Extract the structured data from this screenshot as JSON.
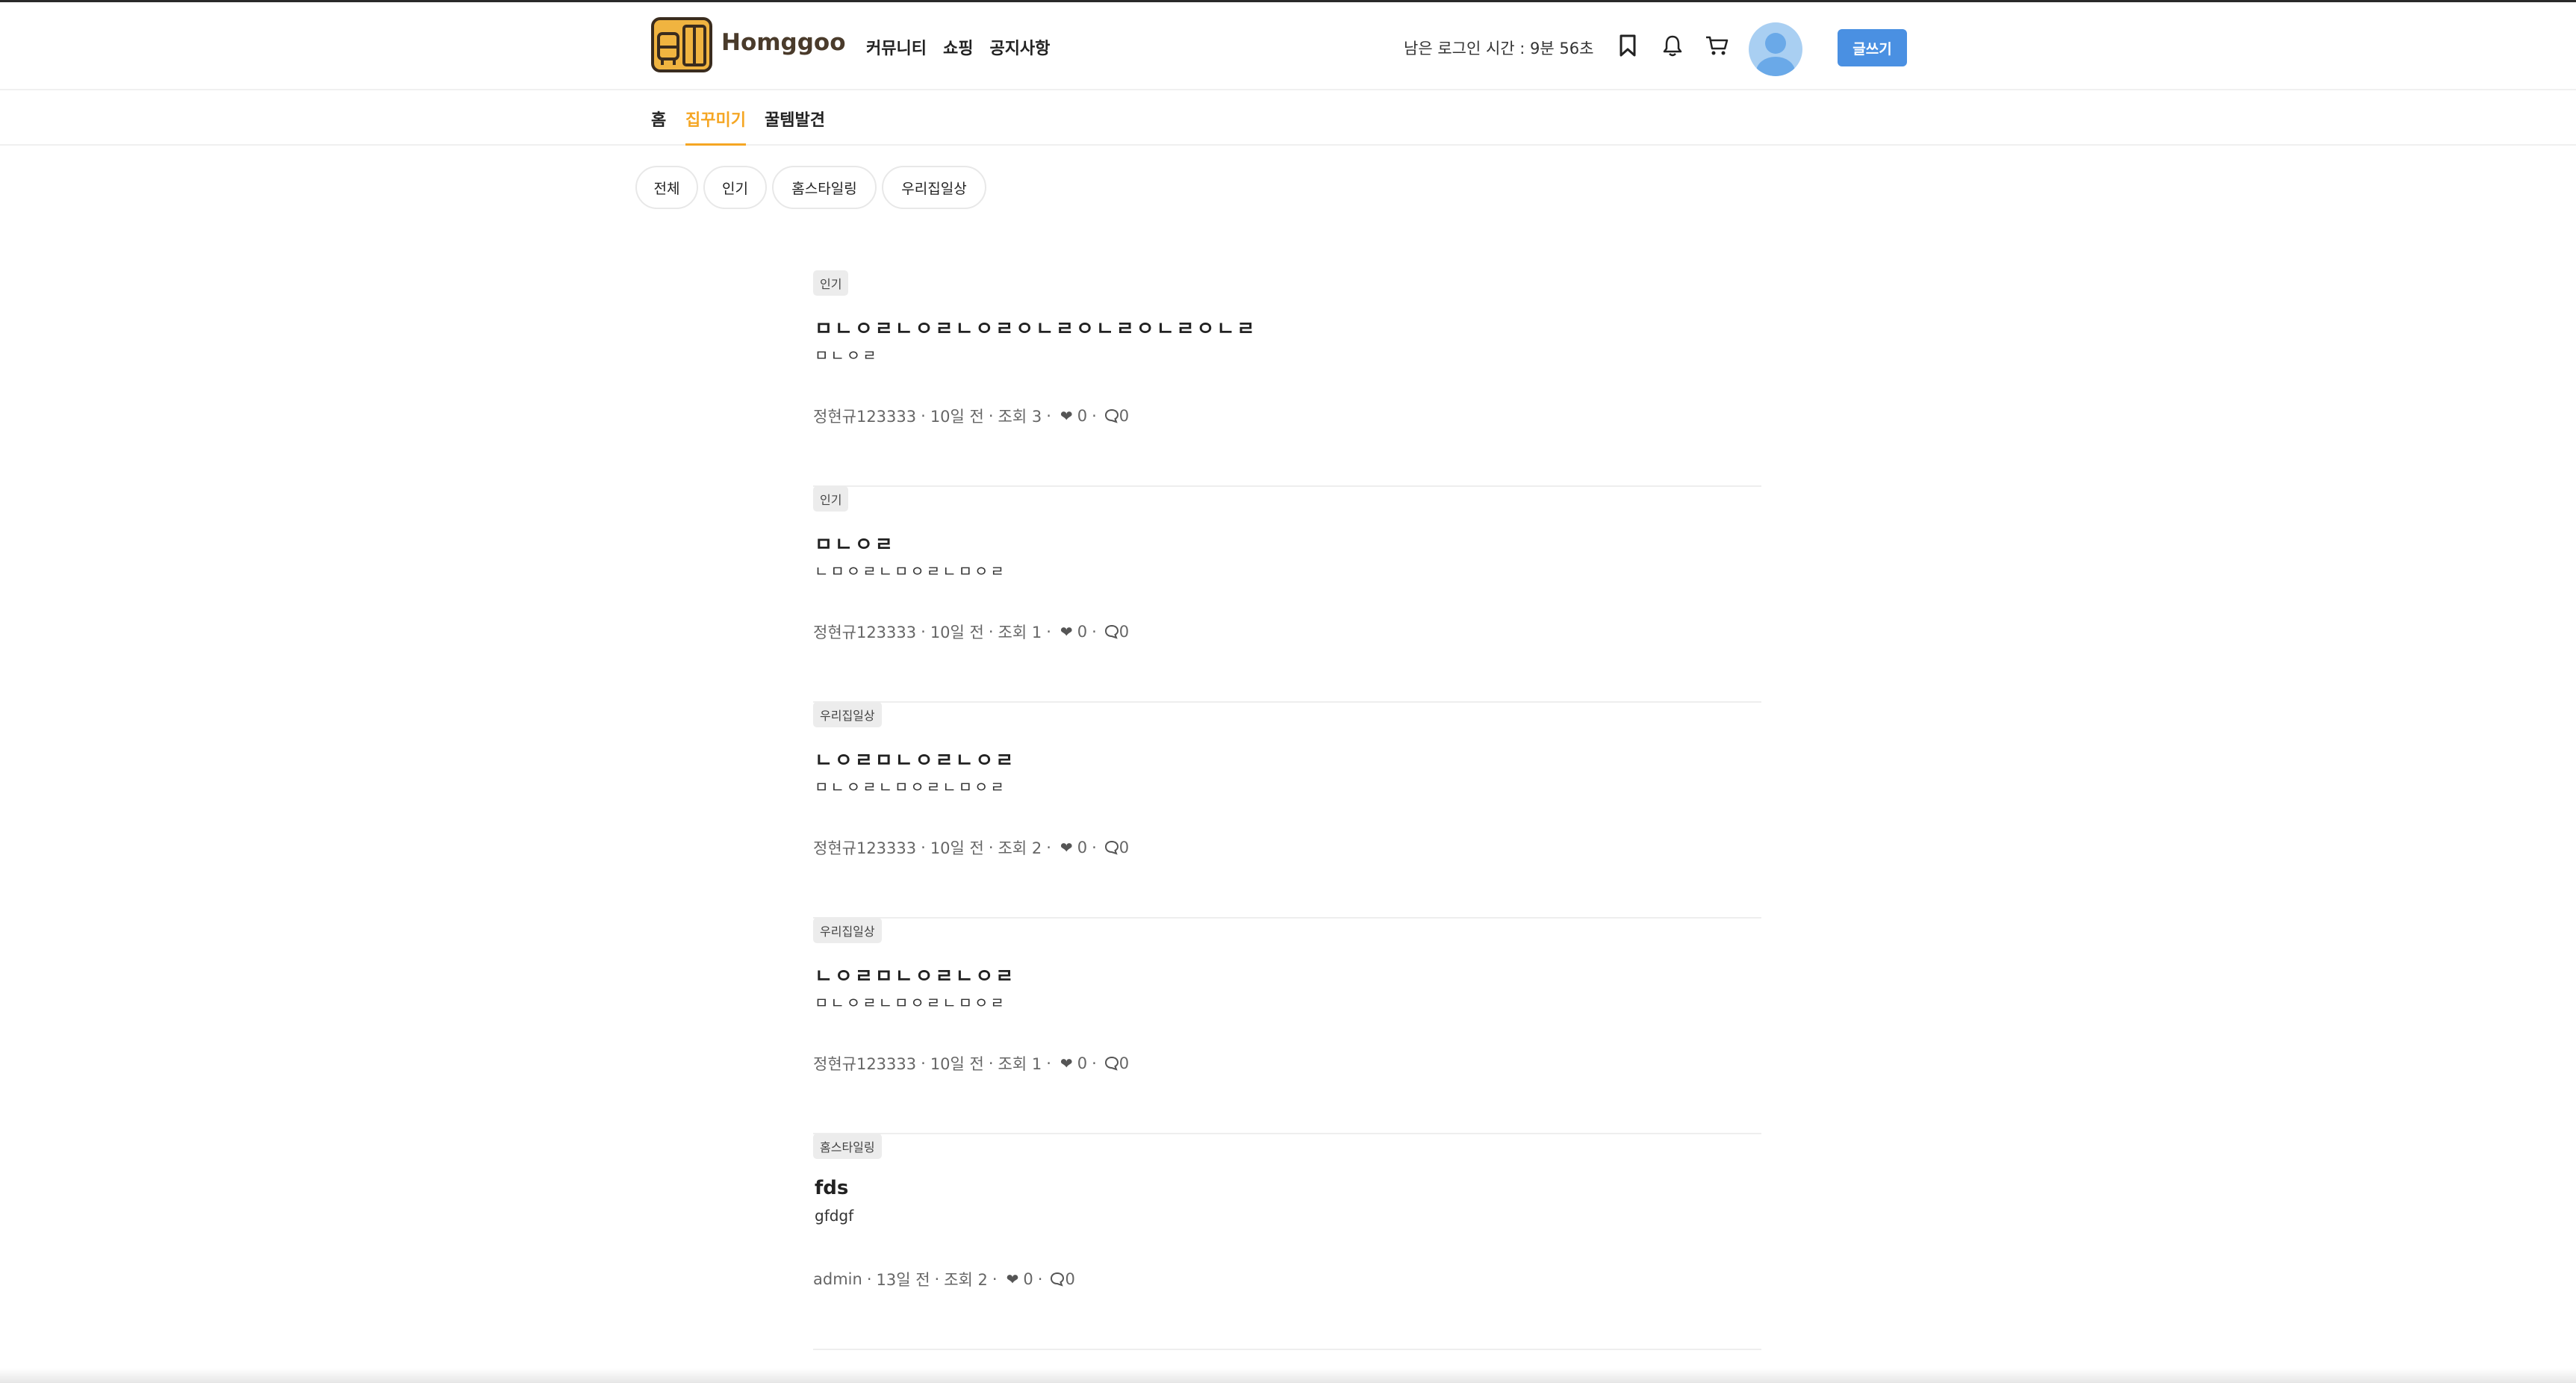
{
  "header": {
    "brand": "Homggoo",
    "nav": [
      "커뮤니티",
      "쇼핑",
      "공지사항"
    ],
    "session_text": "남은 로그인 시간 : 9분 56초",
    "write_label": "글쓰기"
  },
  "subnav": {
    "items": [
      "홈",
      "집꾸미기",
      "꿀템발견"
    ],
    "active": "집꾸미기"
  },
  "filters": [
    "전체",
    "인기",
    "홈스타일링",
    "우리집일상"
  ],
  "posts": [
    {
      "category": "인기",
      "title": "ㅁㄴㅇㄹㄴㅇㄹㄴㅇㄹㅇㄴㄹㅇㄴㄹㅇㄴㄹㅇㄴㄹ",
      "excerpt": "ㅁㄴㅇㄹ",
      "author": "정현규123333",
      "time": "10일 전",
      "views": "조회 3",
      "likes": "0",
      "comments": "0"
    },
    {
      "category": "인기",
      "title": "ㅁㄴㅇㄹ",
      "excerpt": "ㄴㅁㅇㄹㄴㅁㅇㄹㄴㅁㅇㄹ",
      "author": "정현규123333",
      "time": "10일 전",
      "views": "조회 1",
      "likes": "0",
      "comments": "0"
    },
    {
      "category": "우리집일상",
      "title": "ㄴㅇㄹㅁㄴㅇㄹㄴㅇㄹ",
      "excerpt": "ㅁㄴㅇㄹㄴㅁㅇㄹㄴㅁㅇㄹ",
      "author": "정현규123333",
      "time": "10일 전",
      "views": "조회 2",
      "likes": "0",
      "comments": "0"
    },
    {
      "category": "우리집일상",
      "title": "ㄴㅇㄹㅁㄴㅇㄹㄴㅇㄹ",
      "excerpt": "ㅁㄴㅇㄹㄴㅁㅇㄹㄴㅁㅇㄹ",
      "author": "정현규123333",
      "time": "10일 전",
      "views": "조회 1",
      "likes": "0",
      "comments": "0"
    },
    {
      "category": "홈스타일링",
      "title": "fds",
      "excerpt": "gfdgf",
      "author": "admin",
      "time": "13일 전",
      "views": "조회 2",
      "likes": "0",
      "comments": "0"
    }
  ],
  "colors": {
    "accent": "#f5a623",
    "primary": "#4a90e2",
    "brand": "#4a3b2b"
  },
  "icons": [
    "bookmark-icon",
    "bell-icon",
    "cart-icon",
    "heart-icon",
    "comment-icon"
  ]
}
